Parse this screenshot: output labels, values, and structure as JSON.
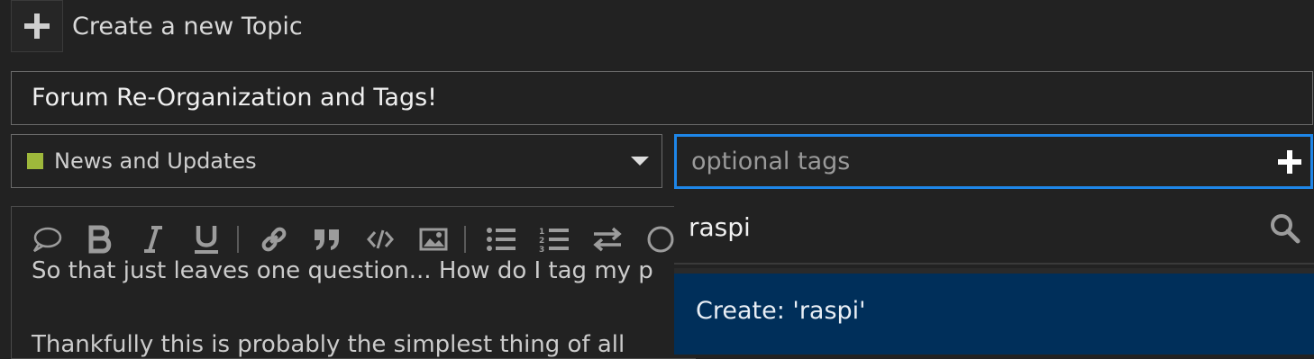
{
  "header": {
    "title": "Create a new Topic",
    "add_icon": "plus-icon"
  },
  "composer": {
    "title_value": "Forum Re-Organization and Tags!",
    "category": {
      "label": "News and Updates",
      "color": "#9eb83b"
    },
    "tags": {
      "placeholder": "optional tags",
      "add_icon": "plus-icon"
    },
    "toolbar": [
      "speech-bubble-icon",
      "bold-icon",
      "italic-icon",
      "underline-icon",
      "link-icon",
      "blockquote-icon",
      "code-icon",
      "image-icon",
      "bullet-list-icon",
      "numbered-list-icon",
      "swap-icon",
      "emoji-icon"
    ],
    "editor_lines": [
      "So that just leaves one question... How do I tag my p",
      "Thankfully this is probably the simplest thing of all"
    ]
  },
  "tag_dropdown": {
    "search_value": "raspi",
    "search_icon": "search-icon",
    "create_option": "Create: 'raspi'"
  },
  "colors": {
    "accent": "#1e86e8",
    "highlight": "#002f5a",
    "background": "#222222"
  }
}
